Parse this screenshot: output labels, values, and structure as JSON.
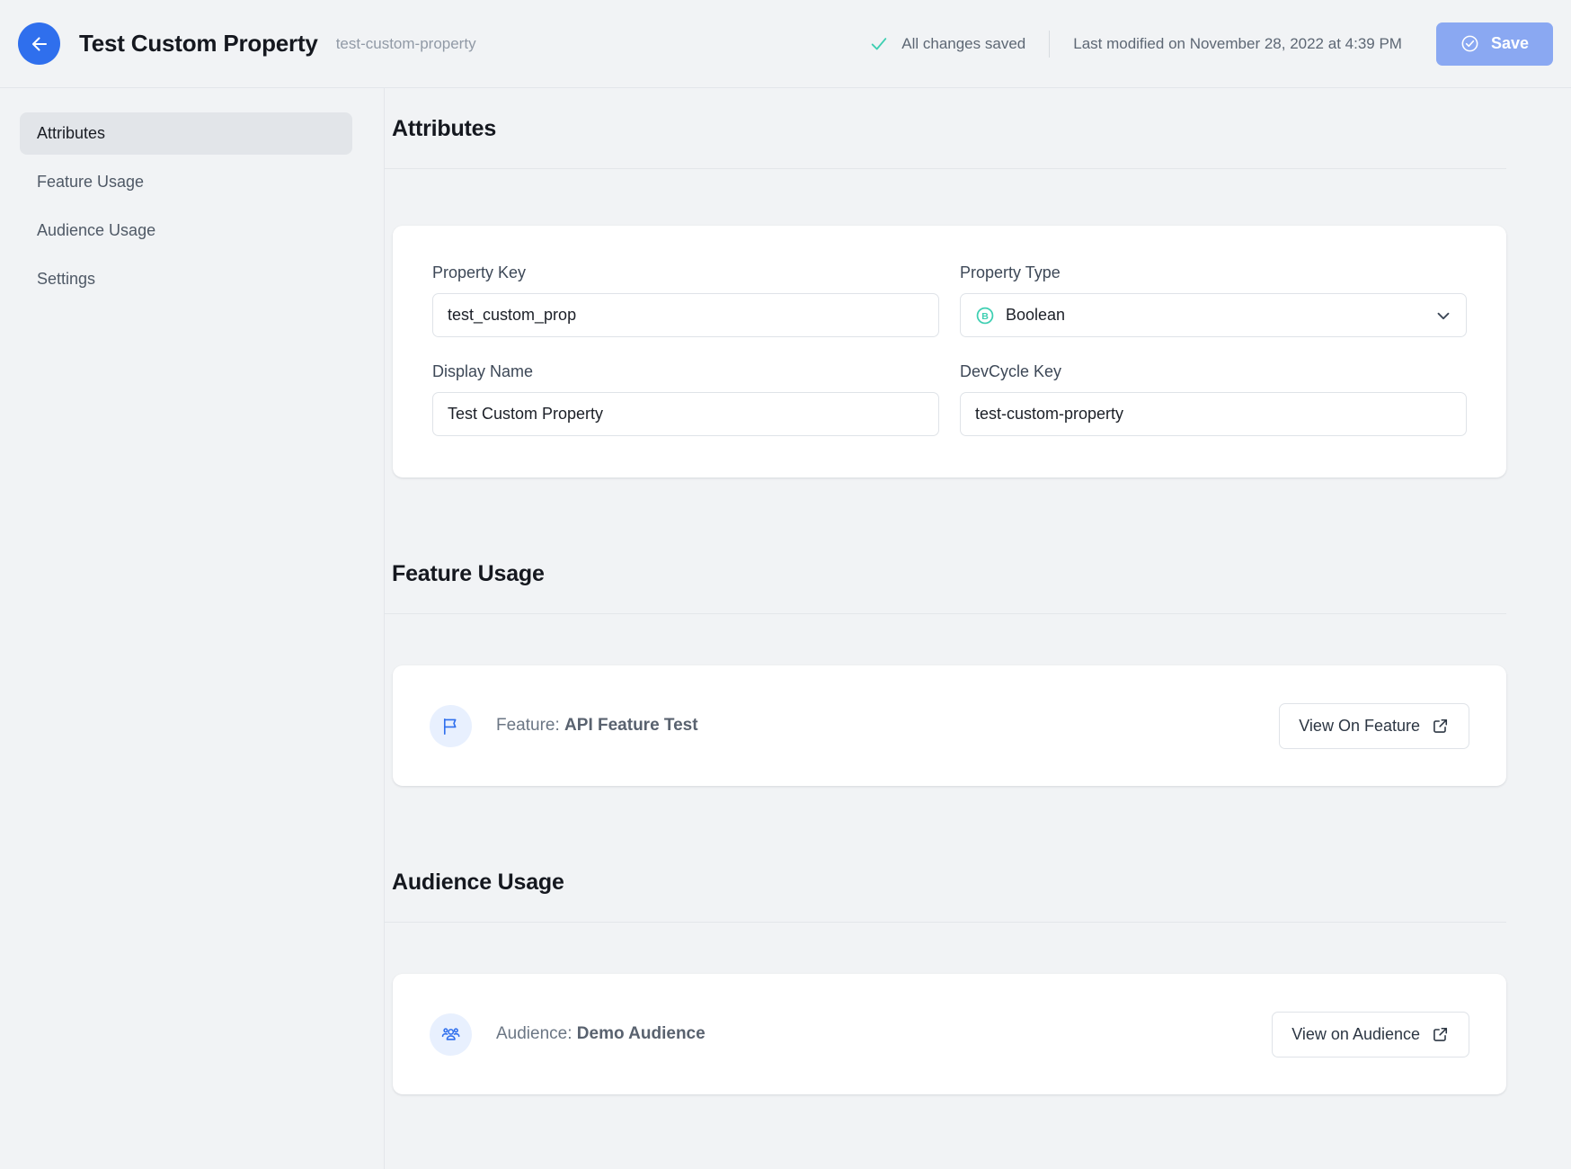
{
  "header": {
    "back_icon": "arrow-left-icon",
    "title": "Test Custom Property",
    "subtitle": "test-custom-property",
    "saved_status": "All changes saved",
    "saved_icon": "check-icon",
    "last_modified": "Last modified on November 28, 2022 at 4:39 PM",
    "save_label": "Save",
    "save_icon": "check-circle-icon",
    "accent_blue": "#2f6fed",
    "save_button_bg": "#8aa8f2",
    "check_teal": "#3ecfb2"
  },
  "sidebar": {
    "items": [
      {
        "label": "Attributes",
        "active": true
      },
      {
        "label": "Feature Usage",
        "active": false
      },
      {
        "label": "Audience Usage",
        "active": false
      },
      {
        "label": "Settings",
        "active": false
      }
    ]
  },
  "sections": {
    "attributes": {
      "heading": "Attributes",
      "fields": {
        "property_key": {
          "label": "Property Key",
          "value": "test_custom_prop",
          "placeholder": "Property Key"
        },
        "property_type": {
          "label": "Property Type",
          "value": "Boolean",
          "icon": "boolean-type-icon",
          "icon_color": "#3ecfb2",
          "chevron": "chevron-down-icon"
        },
        "display_name": {
          "label": "Display Name",
          "value": "Test Custom Property",
          "placeholder": "Display Name"
        },
        "devcycle_key": {
          "label": "DevCycle Key",
          "value": "test-custom-property",
          "placeholder": "DevCycle Key"
        }
      }
    },
    "feature_usage": {
      "heading": "Feature Usage",
      "item": {
        "icon": "flag-icon",
        "prefix": "Feature: ",
        "name": "API Feature Test",
        "button_label": "View On Feature",
        "button_icon": "external-link-icon"
      }
    },
    "audience_usage": {
      "heading": "Audience Usage",
      "item": {
        "icon": "users-group-icon",
        "prefix": "Audience: ",
        "name": "Demo Audience",
        "button_label": "View on Audience",
        "button_icon": "external-link-icon"
      }
    }
  }
}
